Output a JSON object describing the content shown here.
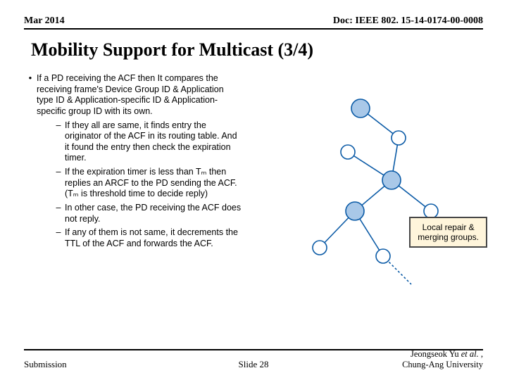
{
  "header": {
    "left": "Mar 2014",
    "right": "Doc: IEEE 802. 15-14-0174-00-0008"
  },
  "title": "Mobility Support for Multicast (3/4)",
  "content": {
    "main": "If a PD receiving the ACF then It compares the receiving frame's Device Group ID & Application type ID & Application-specific ID & Application-specific group ID with its own.",
    "subs": [
      "If they all are same, it finds entry the originator of the ACF in its routing table. And it found the entry then check the expiration timer.",
      "If the expiration timer is less than Tₘ then replies an ARCF to the PD sending the ACF. (Tₘ is threshold time to decide reply)",
      "In other case, the PD receiving the ACF does not reply.",
      "If any of them is not same, it decrements the TTL of the ACF and forwards the ACF."
    ]
  },
  "callout": "Local repair &\nmerging groups.",
  "footer": {
    "left": "Submission",
    "center": "Slide 28",
    "right_line1": "Jeongseok Yu ",
    "right_ital": "et al.",
    "right_line1b": " ,",
    "right_line2": "Chung-Ang University"
  }
}
